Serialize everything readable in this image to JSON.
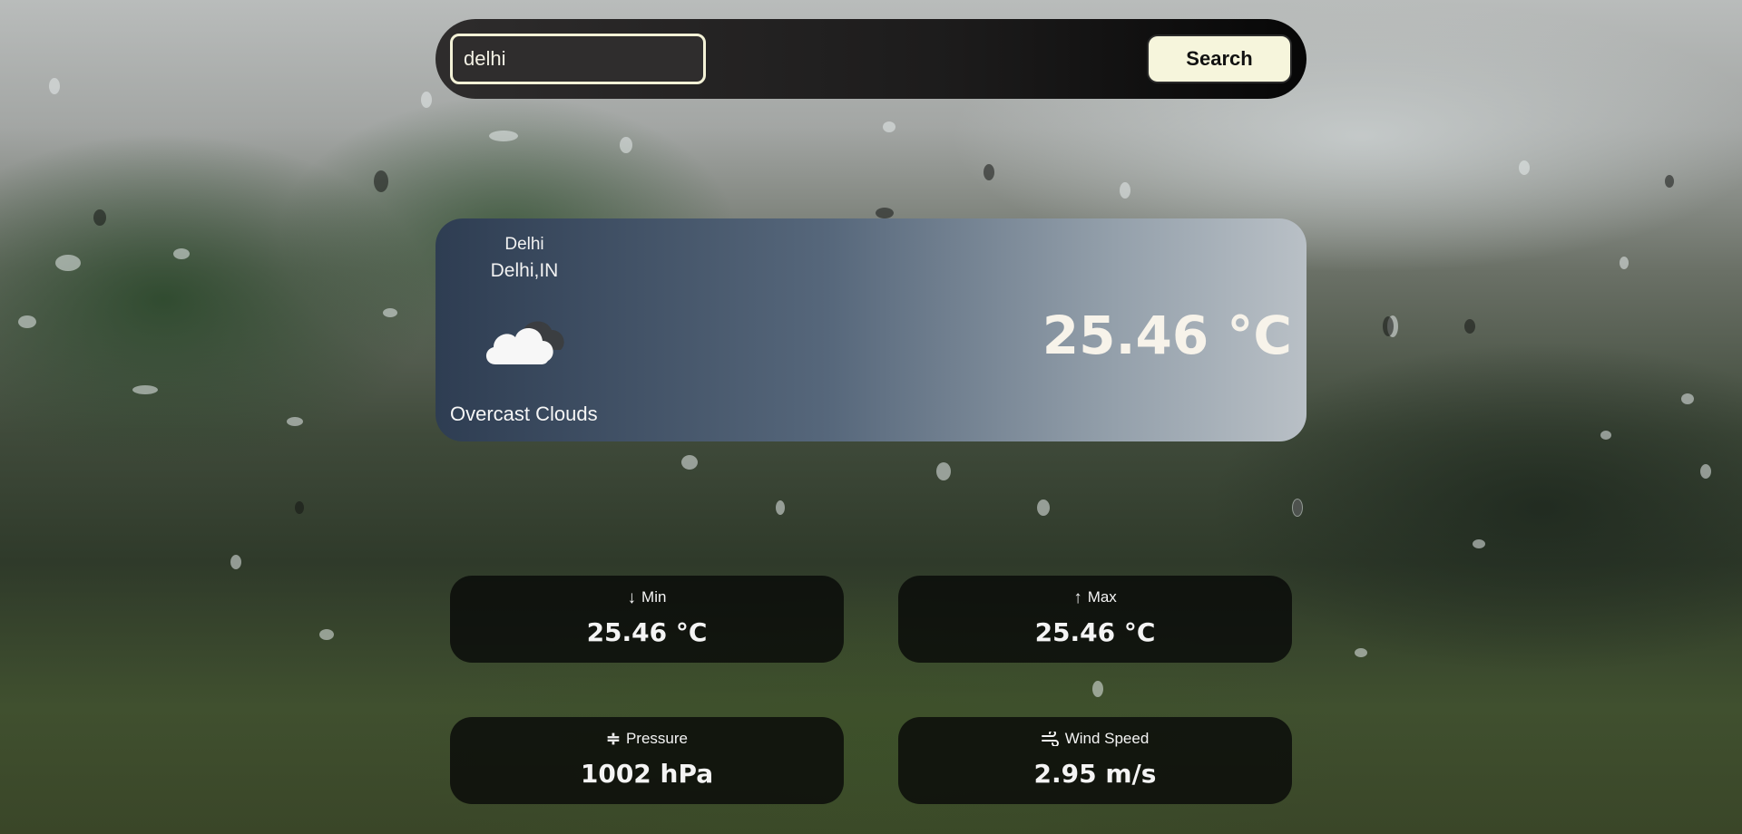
{
  "search": {
    "value": "delhi",
    "button_label": "Search"
  },
  "weather": {
    "city": "Delhi",
    "city_country": "Delhi,IN",
    "icon": "cloud-icon",
    "description": "Overcast Clouds",
    "temperature": "25.46 °C"
  },
  "stats": {
    "min": {
      "label": "Min",
      "icon": "arrow-down-icon",
      "value": "25.46 °C"
    },
    "max": {
      "label": "Max",
      "icon": "arrow-up-icon",
      "value": "25.46 °C"
    },
    "pressure": {
      "label": "Pressure",
      "icon": "pressure-icon",
      "value": "1002 hPa"
    },
    "wind": {
      "label": "Wind Speed",
      "icon": "wind-icon",
      "value": "2.95 m/s"
    }
  }
}
